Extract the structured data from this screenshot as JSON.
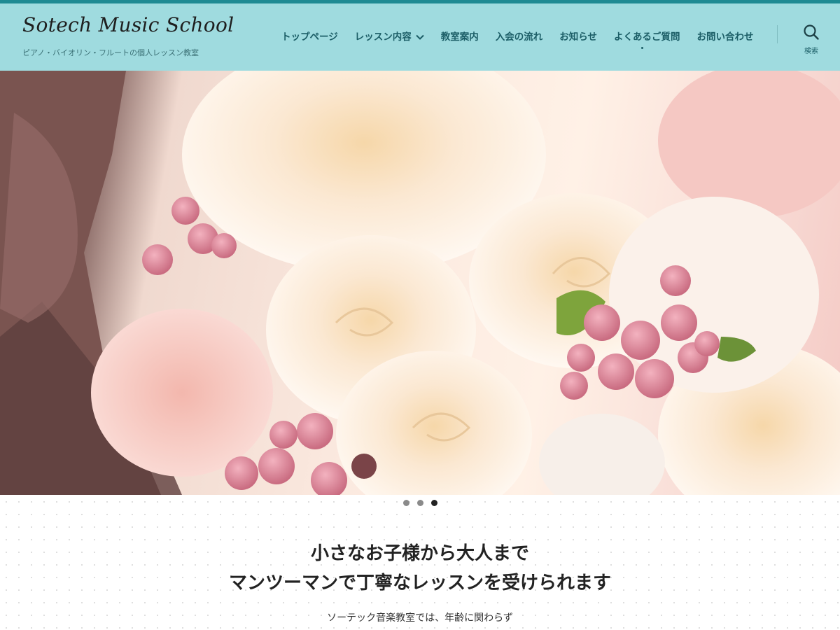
{
  "site": {
    "logo": "Sotech Music School",
    "tagline": "ピアノ・バイオリン・フルートの個人レッスン教室"
  },
  "nav": {
    "items": [
      {
        "label": "トップページ"
      },
      {
        "label": "レッスン内容",
        "has_dropdown": true
      },
      {
        "label": "教室案内"
      },
      {
        "label": "入会の流れ"
      },
      {
        "label": "お知らせ"
      },
      {
        "label": "よくあるご質問"
      },
      {
        "label": "お問い合わせ"
      }
    ],
    "search_label": "検索",
    "search_icon": "search-icon"
  },
  "hero": {
    "image": "rose-bouquet-photo",
    "slides_total": 3,
    "active_slide": 3
  },
  "main": {
    "headline_line1": "小さなお子様から大人まで",
    "headline_line2": "マンツーマンで丁寧なレッスンを受けられます",
    "intro": "ソーテック音楽教室では、年齢に関わらず"
  },
  "colors": {
    "header_bg": "#9fdbdf",
    "top_accent": "#1f8a93",
    "nav_text": "#1b5d66"
  }
}
